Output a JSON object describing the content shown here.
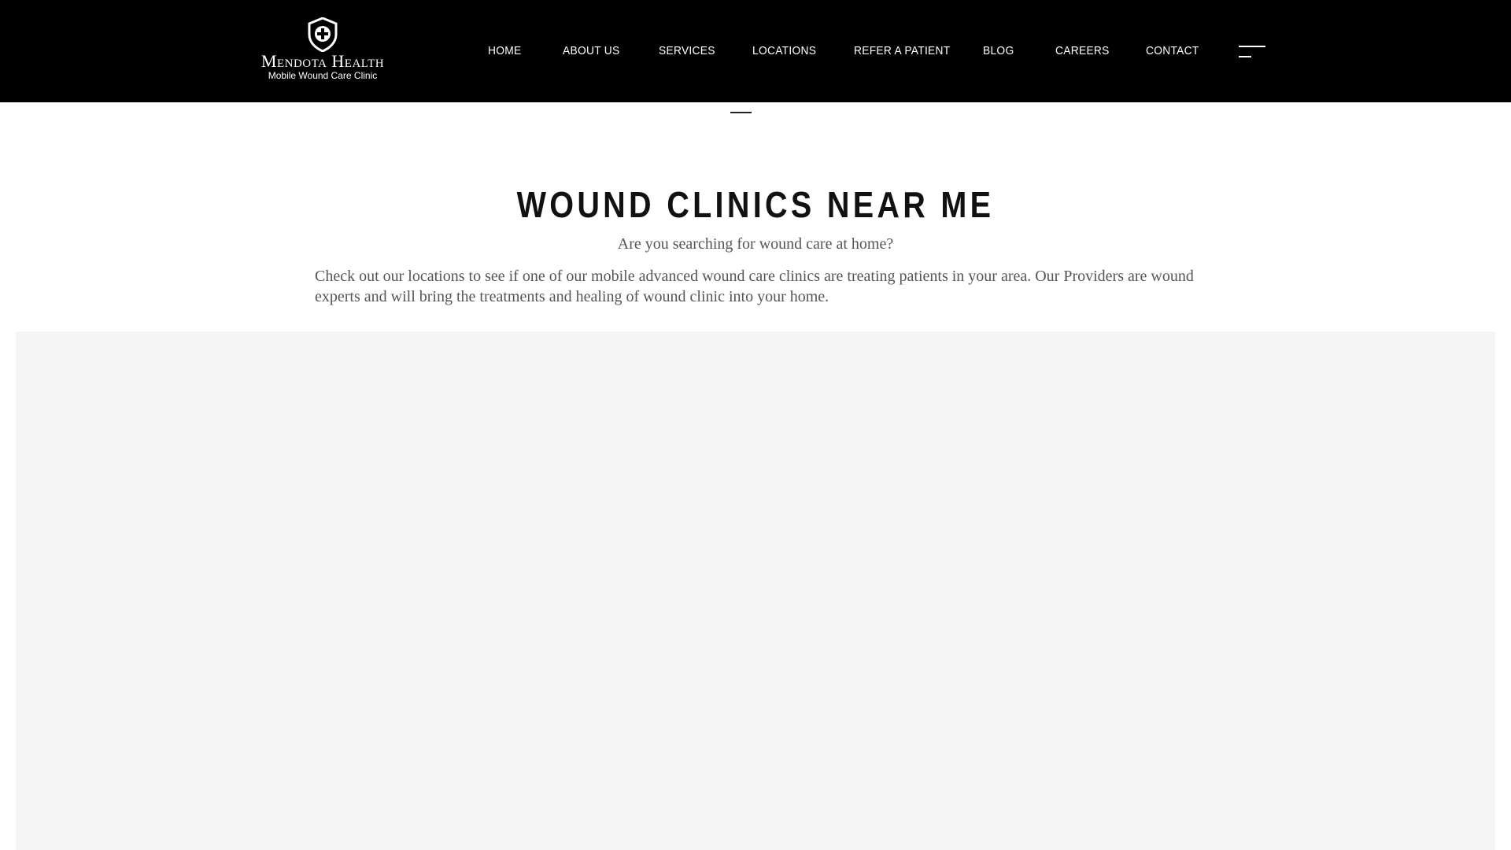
{
  "header": {
    "logo": {
      "title": "Mendota Health",
      "subtitle": "Mobile Wound Care Clinic"
    },
    "nav": [
      {
        "label": "HOME"
      },
      {
        "label": "ABOUT US"
      },
      {
        "label": "SERVICES"
      },
      {
        "label": "LOCATIONS"
      },
      {
        "label": "REFER A PATIENT"
      },
      {
        "label": "BLOG"
      },
      {
        "label": "CAREERS"
      },
      {
        "label": "CONTACT"
      }
    ],
    "menu_icon": "hamburger-menu-icon",
    "colors": {
      "background": "#000000",
      "text": "#ffffff"
    }
  },
  "main": {
    "title": "WOUND CLINICS NEAR ME",
    "subtitle": "Are you searching for wound care at home?",
    "body": "Check out our locations to see if one of our mobile advanced wound care clinics are treating patients in your area. Our Providers are wound experts and will bring the treatments and healing of wound clinic into your home.",
    "map_background": "#f5f5f5"
  }
}
